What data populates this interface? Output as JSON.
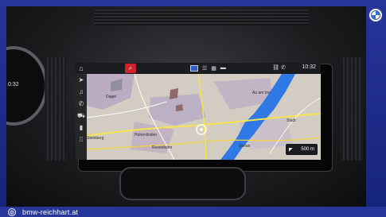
{
  "nav_screen": {
    "status_time": "10:32",
    "scale": "500 m",
    "cluster_time": "0:32",
    "map_labels": [
      "Dagel",
      "Au am Inn",
      "Stadt",
      "Hohenlinden",
      "Steinberg",
      "Rosenheim",
      "Stefan"
    ]
  },
  "footer": {
    "website": "bmw-reichhart.at"
  },
  "colors": {
    "frame_blue": "#27349a",
    "search_red": "#d3212b",
    "river_blue": "#2f79e6"
  }
}
